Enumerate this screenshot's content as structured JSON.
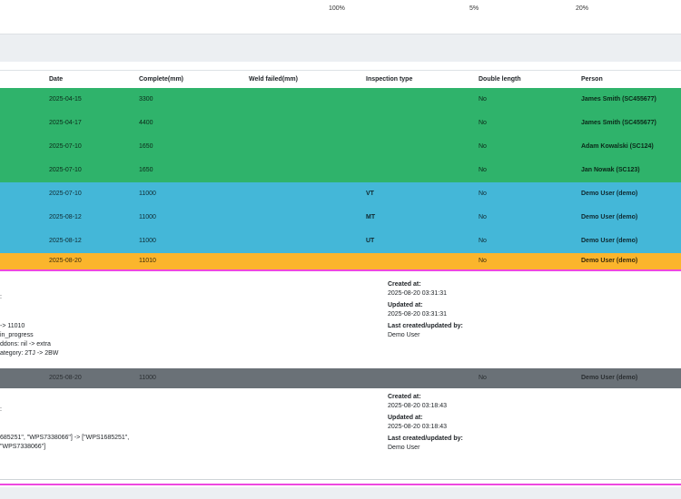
{
  "top_percentages": [
    "100%",
    "5%",
    "20%"
  ],
  "table": {
    "headers": {
      "date": "Date",
      "complete": "Complete(mm)",
      "weld_failed": "Weld failed(mm)",
      "inspection_type": "Inspection type",
      "double_length": "Double length",
      "person": "Person"
    },
    "rows": [
      {
        "date": "2025-04-15",
        "complete": "3300",
        "weld_failed": "",
        "inspection_type": "",
        "double_length": "No",
        "person": "James Smith (SC455677)",
        "color": "#2fb36b"
      },
      {
        "date": "2025-04-17",
        "complete": "4400",
        "weld_failed": "",
        "inspection_type": "",
        "double_length": "No",
        "person": "James Smith (SC455677)",
        "color": "#2fb36b"
      },
      {
        "date": "2025-07-10",
        "complete": "1650",
        "weld_failed": "",
        "inspection_type": "",
        "double_length": "No",
        "person": "Adam Kowalski (SC124)",
        "color": "#2fb36b"
      },
      {
        "date": "2025-07-10",
        "complete": "1650",
        "weld_failed": "",
        "inspection_type": "",
        "double_length": "No",
        "person": "Jan Nowak (SC123)",
        "color": "#2fb36b"
      },
      {
        "date": "2025-07-10",
        "complete": "11000",
        "weld_failed": "",
        "inspection_type": "VT",
        "double_length": "No",
        "person": "Demo User (demo)",
        "color": "#44b7d8"
      },
      {
        "date": "2025-08-12",
        "complete": "11000",
        "weld_failed": "",
        "inspection_type": "MT",
        "double_length": "No",
        "person": "Demo User (demo)",
        "color": "#44b7d8"
      },
      {
        "date": "2025-08-12",
        "complete": "11000",
        "weld_failed": "",
        "inspection_type": "UT",
        "double_length": "No",
        "person": "Demo User (demo)",
        "color": "#44b7d8"
      },
      {
        "date": "2025-08-20",
        "complete": "11010",
        "weld_failed": "",
        "inspection_type": "",
        "double_length": "No",
        "person": "Demo User (demo)",
        "color": "#fbb52c"
      }
    ],
    "grey_row": {
      "date": "2025-08-20",
      "complete": "11000",
      "weld_failed": "",
      "inspection_type": "",
      "double_length": "No",
      "person": "Demo User (demo)",
      "color": "#6a7177"
    }
  },
  "detail1": {
    "left_lines": [
      ":",
      "",
      "",
      "-> 11010",
      "in_progress",
      "ddons: nil -> extra",
      "ategory: 2TJ -> 2BW"
    ],
    "created_label": "Created at:",
    "created_value": "2025-08-20 03:31:31",
    "updated_label": "Updated at:",
    "updated_value": "2025-08-20 03:31:31",
    "last_label": "Last created/updated by:",
    "last_value": "Demo User"
  },
  "detail2": {
    "left_lines": [
      ":",
      "",
      "",
      "685251\", \"WPS7338066\"] -> [\"WPS1685251\",",
      "\"WPS7338066\"]"
    ],
    "created_label": "Created at:",
    "created_value": "2025-08-20 03:18:43",
    "updated_label": "Updated at:",
    "updated_value": "2025-08-20 03:18:43",
    "last_label": "Last created/updated by:",
    "last_value": "Demo User"
  },
  "colors": {
    "green": "#2fb36b",
    "blue": "#44b7d8",
    "orange": "#fbb52c",
    "grey": "#6a7177",
    "pink": "#ee48e0"
  }
}
